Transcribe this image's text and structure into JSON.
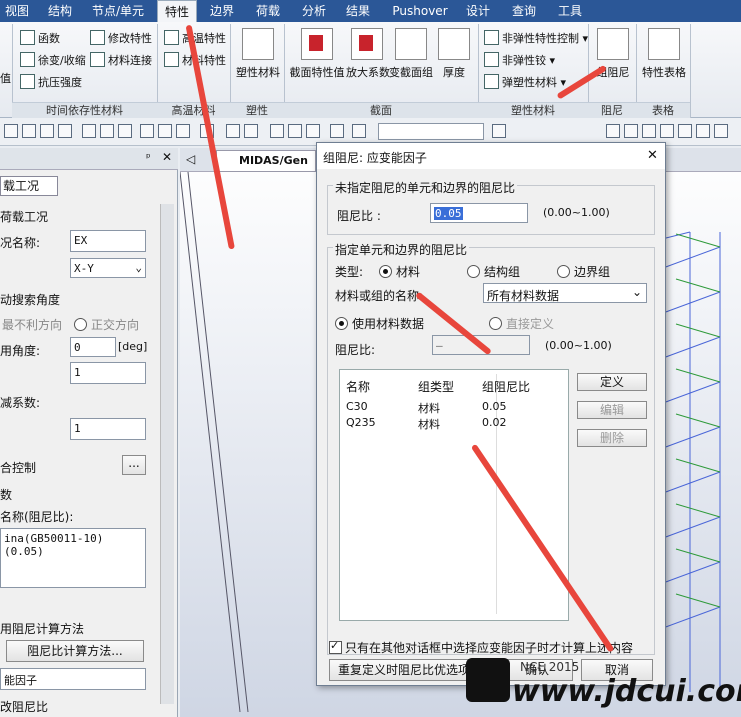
{
  "menubar": {
    "items": [
      "视图",
      "结构",
      "节点/单元",
      "特性",
      "边界",
      "荷载",
      "分析",
      "结果",
      "Pushover",
      "设计",
      "查询",
      "工具"
    ]
  },
  "ribbon": {
    "timedep": {
      "items": [
        "函数",
        "修改特性",
        "徐变/收缩",
        "材料连接",
        "抗压强度"
      ],
      "label": "时间依存性材料",
      "left_fragment": "值"
    },
    "hightemp": {
      "items": [
        "高温特性",
        "材料特性"
      ],
      "label": "高温材料"
    },
    "plastic": {
      "big": "塑性材料",
      "label": "塑性"
    },
    "section": {
      "big": [
        "截面特性值",
        "放大系数",
        "变截面组",
        "厚度"
      ],
      "label": "截面"
    },
    "inelastic": {
      "items": [
        "非弹性特性控制",
        "非弹性铰",
        "弹塑性材料"
      ],
      "label": "塑性材料"
    },
    "damping": {
      "big": "组阻尼",
      "label": "阻尼"
    },
    "table": {
      "big": "特性表格",
      "label": "表格"
    }
  },
  "leftpanel": {
    "tab": "载工况",
    "section1": "荷载工况",
    "case_name_label": "况名称:",
    "case_name_value": "EX",
    "direction_value": "X-Y",
    "search_angle": "动搜索角度",
    "unfav_dir": "最不利方向",
    "orth_dir": "正交方向",
    "use_angle_label": "用角度:",
    "angle_value": "0",
    "angle_unit": "[deg]",
    "field1_value": "1",
    "reduction_label": "减系数:",
    "reduction_value": "1",
    "combo_label": "合控制",
    "dots": "...",
    "section2": "数",
    "damping_name_label": "名称(阻尼比):",
    "damping_list_item": "ina(GB50011-10) (0.05)",
    "method_label": "用阻尼计算方法",
    "method_button": "阻尼比计算方法...",
    "strain_factor": "能因子",
    "modify_damping": "改阻尼比"
  },
  "viewport": {
    "tab": "MIDAS/Gen"
  },
  "dialog": {
    "title": "组阻尼: 应变能因子",
    "close": "✕",
    "group1_title": "未指定阻尼的单元和边界的阻尼比",
    "damping_ratio_label": "阻尼比 :",
    "damping_ratio_value": "0.05",
    "range1": "(0.00~1.00)",
    "group2_title": "指定单元和边界的阻尼比",
    "type_label": "类型:",
    "type_options": [
      "材料",
      "结构组",
      "边界组"
    ],
    "name_label": "材料或组的名称:",
    "name_select_value": "所有材料数据",
    "use_material_data": "使用材料数据",
    "direct_define": "直接定义",
    "damping_ratio2_label": "阻尼比:",
    "damping_ratio2_value": "—",
    "range2": "(0.00~1.00)",
    "table_headers": [
      "名称",
      "组类型",
      "组阻尼比"
    ],
    "table_rows": [
      [
        "C30",
        "材料",
        "0.05"
      ],
      [
        "Q235",
        "材料",
        "0.02"
      ]
    ],
    "btn_define": "定义",
    "btn_edit": "编辑",
    "btn_delete": "删除",
    "checkbox_text": "只有在其他对话框中选择应变能因子时才计算上述内容",
    "btn_reset": "重复定义时阻尼比优选项",
    "btn_ok": "确认",
    "btn_cancel": "取消"
  },
  "watermark": {
    "text": "www.jdcui.com",
    "mid": "NCE 2015"
  },
  "colors": {
    "menubar": "#2b5797",
    "annotation_arrow": "#e8463c",
    "frame_blue": "#2a2ad0",
    "frame_green": "#2e9a3a"
  }
}
